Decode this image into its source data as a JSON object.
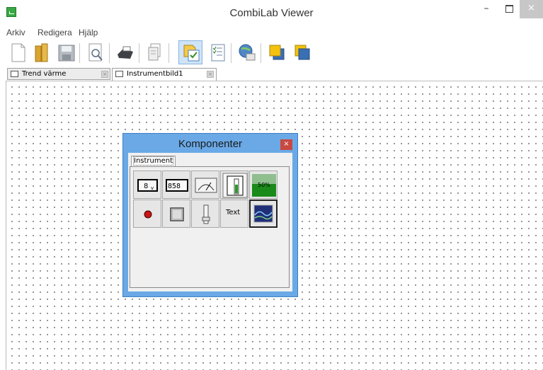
{
  "window": {
    "title": "CombiLab Viewer",
    "min": "–",
    "close": "×"
  },
  "menu": [
    "Arkiv",
    "Redigera",
    "Hjälp"
  ],
  "toolbar": [
    "new-icon",
    "open-icon",
    "save-icon",
    "preview-icon",
    "print-icon",
    "copy-icon",
    "components-icon",
    "properties-icon",
    "connect-icon",
    "front-icon",
    "back-icon"
  ],
  "tabs": [
    {
      "label": "Trend värme",
      "active": false
    },
    {
      "label": "Instrumentbild1",
      "active": true
    }
  ],
  "dialog": {
    "title": "Komponenter",
    "close": "×",
    "tab": "Instrument",
    "items": [
      {
        "name": "digital-display",
        "text": "8"
      },
      {
        "name": "numeric-display",
        "text": "858"
      },
      {
        "name": "analog-meter"
      },
      {
        "name": "bar-gauge"
      },
      {
        "name": "percent-bar",
        "text": "50%"
      },
      {
        "name": "indicator-lamp"
      },
      {
        "name": "button"
      },
      {
        "name": "slider"
      },
      {
        "name": "text-label",
        "text": "Text"
      },
      {
        "name": "trend-chart"
      }
    ]
  },
  "colors": {
    "accent": "#6aa9e6",
    "close": "#c9483f",
    "green": "#1a8a1a"
  }
}
